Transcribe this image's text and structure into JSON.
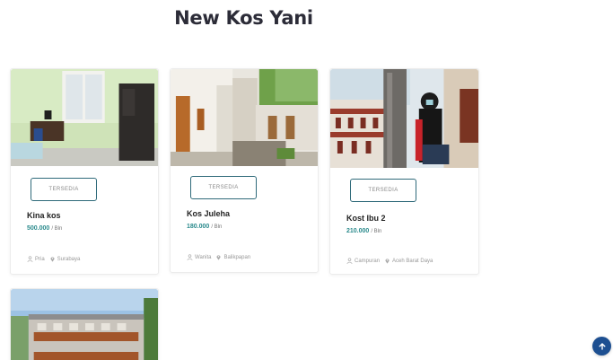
{
  "page": {
    "title": "New Kos Yani"
  },
  "listings": [
    {
      "status": "TERSEDIA",
      "name": "Kina kos",
      "price": "500.000",
      "period": "/ Bln",
      "gender": "Pria",
      "city": "Surabaya"
    },
    {
      "status": "TERSEDIA",
      "name": "Kos Juleha",
      "price": "180.000",
      "period": "/ Bln",
      "gender": "Wanita",
      "city": "Balikpapan"
    },
    {
      "status": "TERSEDIA",
      "name": "Kost Ibu 2",
      "price": "210.000",
      "period": "/ Bln",
      "gender": "Campuran",
      "city": "Aceh Barat Daya"
    }
  ],
  "icons": {
    "gender": "person-icon",
    "location": "map-pin-icon",
    "scroll_top": "arrow-up-icon"
  },
  "colors": {
    "accent": "#2a8a8c",
    "button_border": "#2f6a7a",
    "scroll_button": "#1d4f91"
  }
}
